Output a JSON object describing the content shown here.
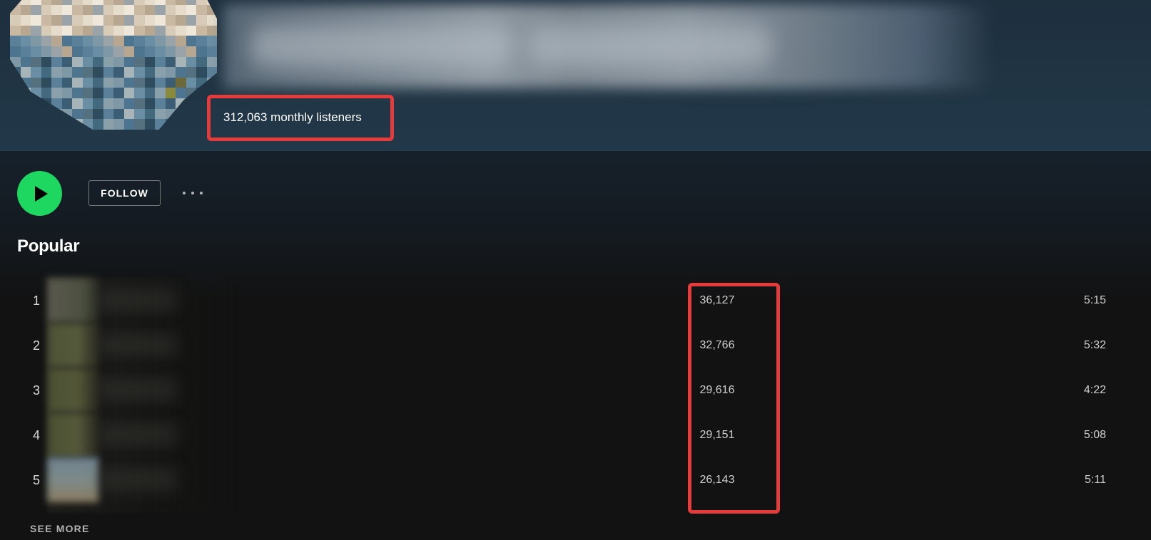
{
  "artist": {
    "monthly_listeners": "312,063 monthly listeners"
  },
  "actions": {
    "play_icon": "play-icon",
    "follow_label": "FOLLOW",
    "more_icon": "more-options-icon"
  },
  "colors": {
    "accent": "#1ed760",
    "highlight": "#e53b3b",
    "background": "#121212"
  },
  "popular": {
    "title": "Popular",
    "tracks": [
      {
        "number": "1",
        "plays": "36,127",
        "duration": "5:15"
      },
      {
        "number": "2",
        "plays": "32,766",
        "duration": "5:32"
      },
      {
        "number": "3",
        "plays": "29,616",
        "duration": "4:22"
      },
      {
        "number": "4",
        "plays": "29,151",
        "duration": "5:08"
      },
      {
        "number": "5",
        "plays": "26,143",
        "duration": "5:11"
      }
    ],
    "see_more_label": "SEE MORE"
  }
}
